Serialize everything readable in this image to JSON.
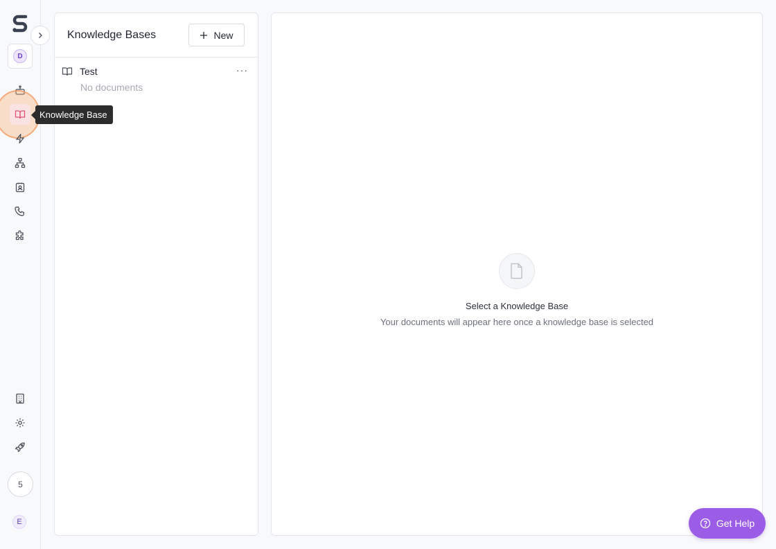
{
  "rail": {
    "workspace_initial": "D",
    "tooltip": "Knowledge Base",
    "progress_count": "5",
    "user_initial": "E",
    "icons": [
      "bot-icon",
      "book-icon",
      "bolt-icon",
      "network-icon",
      "contact-icon",
      "phone-icon",
      "puzzle-icon",
      "building-icon",
      "gear-icon",
      "rocket-icon"
    ]
  },
  "kb_panel": {
    "title": "Knowledge Bases",
    "new_label": "New",
    "items": [
      {
        "name": "Test",
        "subtitle": "No documents",
        "more": "···"
      }
    ]
  },
  "main": {
    "empty_title": "Select a Knowledge Base",
    "empty_subtitle": "Your documents will appear here once a knowledge base is selected"
  },
  "help": {
    "label": "Get Help"
  },
  "colors": {
    "accent": "#9b5de5",
    "active_nav_bg": "#fbe3e3",
    "highlight": "#f5965a"
  }
}
